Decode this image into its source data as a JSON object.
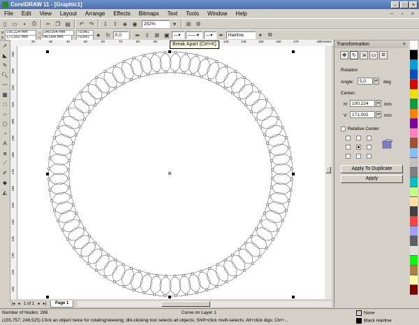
{
  "window": {
    "title": "CorelDRAW 11 - [Graphic1]"
  },
  "menu": [
    "File",
    "Edit",
    "View",
    "Layout",
    "Arrange",
    "Effects",
    "Bitmaps",
    "Text",
    "Tools",
    "Window",
    "Help"
  ],
  "toolbar": {
    "zoom": "252%"
  },
  "propbar": {
    "x": "100,224 mm",
    "y": "171,002 mm",
    "w": "140,004 mm",
    "h": "140,004 mm",
    "sx": "79,841",
    "sy": "79,841",
    "angle": "0,0",
    "outline_width": "Hairline"
  },
  "tooltip": "Break Apart (Ctrl+K)",
  "ruler": {
    "h_ticks": [
      "20",
      "30",
      "40",
      "50",
      "60",
      "70",
      "80",
      "90",
      "100",
      "110",
      "120",
      "130",
      "140",
      "150",
      "160",
      "170"
    ],
    "unit": "millimeters",
    "v_ticks": [
      "240",
      "230",
      "220",
      "210",
      "200",
      "190",
      "180",
      "170",
      "160",
      "150",
      "140",
      "130",
      "120",
      "110",
      "100"
    ]
  },
  "page_nav": {
    "count": "1 of 1",
    "tab": "Page 1"
  },
  "docker": {
    "title": "Transformation",
    "section": "Rotation",
    "angle_label": "Angle:",
    "angle_value": "5,0",
    "angle_unit": "deg",
    "center_label": "Center:",
    "h_label": "H:",
    "h_value": "100,224",
    "v_label": "V:",
    "v_value": "171,002",
    "unit": "mm",
    "relative_center": "Relative Center",
    "apply_dup": "Apply To Duplicate",
    "apply": "Apply"
  },
  "palette": [
    "#ffffff",
    "#000000",
    "#00a0e0",
    "#0050c0",
    "#e00000",
    "#f0e000",
    "#00a040",
    "#ff7f00",
    "#8000a0",
    "#ff80c0",
    "#a0522d",
    "#80c0ff",
    "#c0c0c0",
    "#808080",
    "#00c0c0",
    "#c0ff80",
    "#ffe0a0",
    "#404040",
    "#ff4040",
    "#a0a0ff",
    "#606060",
    "#e0e0e0",
    "#00ff00",
    "#b08040",
    "#ffffa0",
    "#800000"
  ],
  "status": {
    "nodes": "Number of Nodes: 288",
    "layer": "Curve on Layer 1",
    "coords": "(155,757; 248,525)",
    "hint": "Click an object twice for rotating/skewing; dbl-clicking tool selects all objects; Shift+click multi-selects; Alt+click digs; Ctrl+...",
    "fill": "None",
    "outline": "Black  Hairline"
  }
}
